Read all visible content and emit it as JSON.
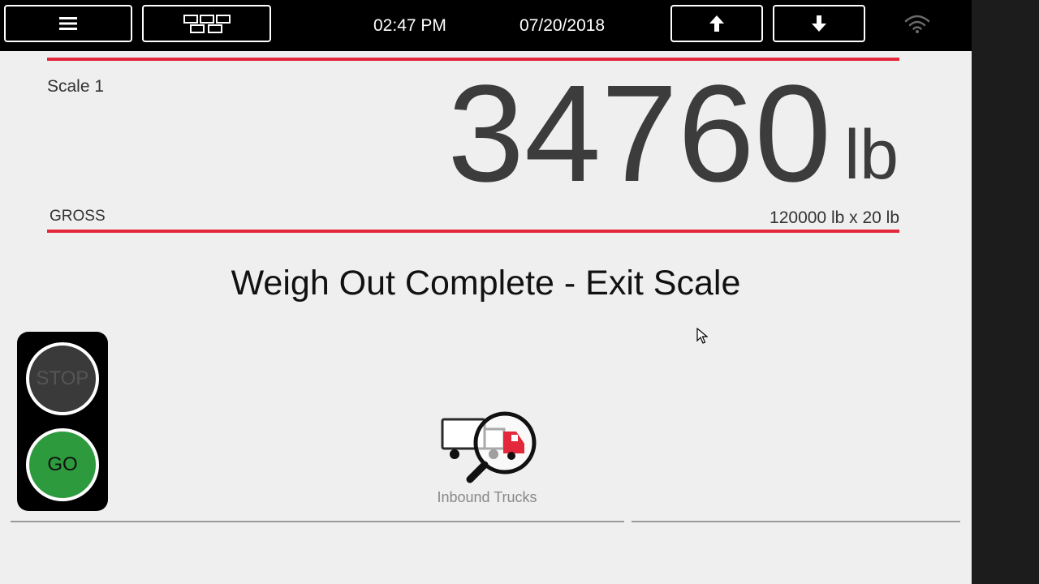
{
  "topbar": {
    "menu_icon": "hamburger-menu-icon",
    "layout_icon": "grid-layout-icon",
    "time": "02:47 PM",
    "date": "07/20/2018",
    "up_icon": "arrow-up-icon",
    "down_icon": "arrow-down-icon",
    "wifi_icon": "wifi-icon"
  },
  "scale": {
    "name": "Scale 1",
    "weight": "34760",
    "unit": "lb",
    "mode": "GROSS",
    "capacity": "120000 lb x 20 lb"
  },
  "status": {
    "message": "Weigh Out Complete - Exit Scale"
  },
  "traffic_light": {
    "stop_label": "STOP",
    "go_label": "GO",
    "active": "go"
  },
  "actions": {
    "inbound_label": "Inbound Trucks",
    "inbound_icon": "truck-search-icon"
  },
  "colors": {
    "accent_red": "#e4283b",
    "go_green": "#2e9a3e",
    "topbar_bg": "#000000"
  }
}
